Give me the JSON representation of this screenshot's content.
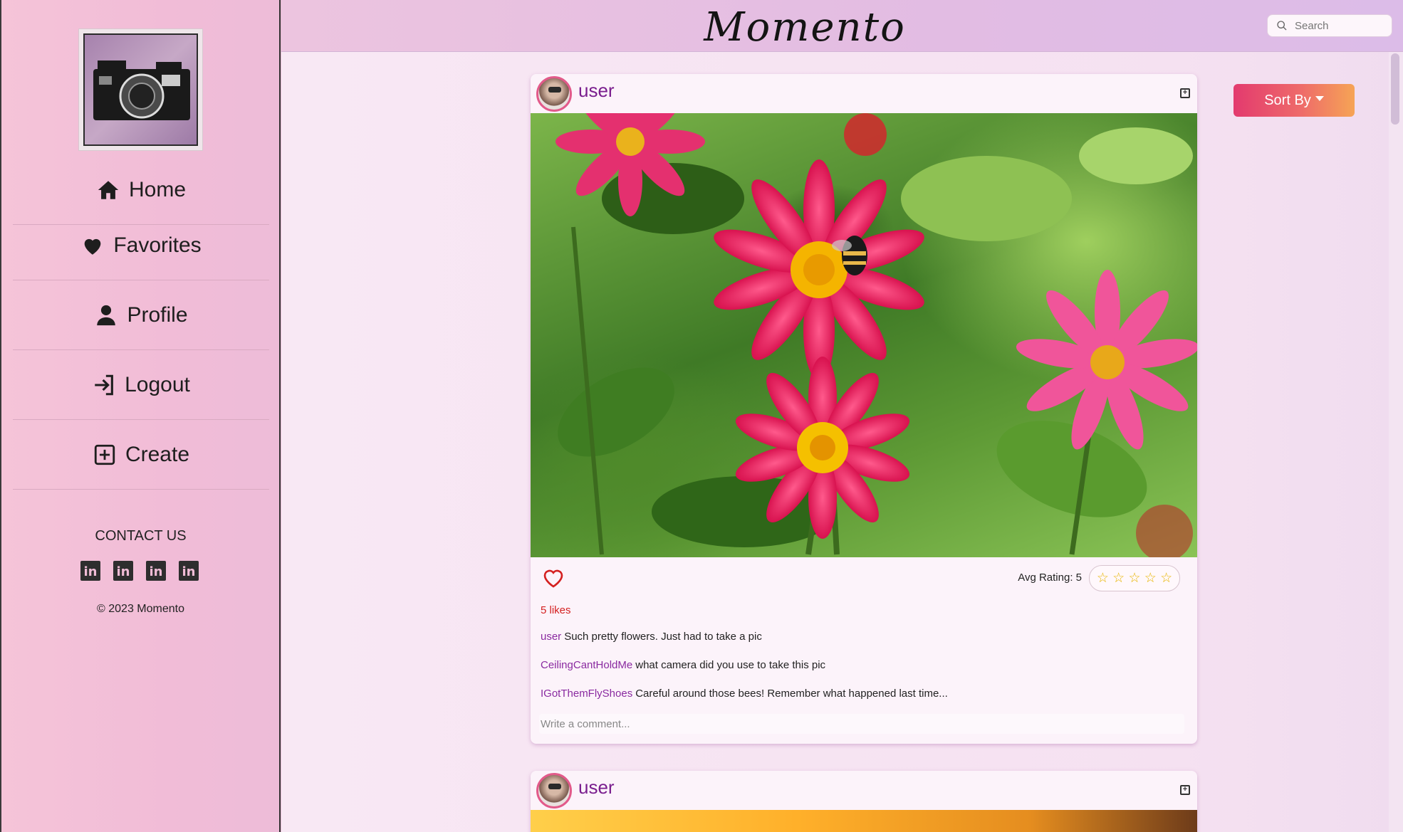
{
  "app": {
    "title": "Momento"
  },
  "header": {
    "search_placeholder": "Search"
  },
  "sidebar": {
    "items": [
      {
        "label": "Home",
        "icon": "home-icon"
      },
      {
        "label": "Favorites",
        "icon": "heart-icon"
      },
      {
        "label": "Profile",
        "icon": "user-icon"
      },
      {
        "label": "Logout",
        "icon": "logout-icon"
      },
      {
        "label": "Create",
        "icon": "plus-square-icon"
      }
    ],
    "contact_label": "CONTACT US",
    "social": [
      "in",
      "in",
      "in",
      "in"
    ],
    "copyright": "© 2023 Momento"
  },
  "toolbar": {
    "sort_label": "Sort By"
  },
  "posts": [
    {
      "username": "user",
      "likes_text": "5 likes",
      "rating_label": "Avg Rating: 5",
      "stars": "☆ ☆ ☆ ☆ ☆",
      "comments": [
        {
          "user": "user",
          "text": "Such pretty flowers. Just had to take a pic"
        },
        {
          "user": "CeilingCantHoldMe",
          "text": "what camera did you use to take this pic"
        },
        {
          "user": "IGotThemFlyShoes",
          "text": "Careful around those bees! Remember what happened last time..."
        }
      ],
      "comment_placeholder": "Write a comment..."
    },
    {
      "username": "user"
    }
  ],
  "colors": {
    "accent_purple": "#7a1e8e",
    "likes_red": "#d42020",
    "sort_gradient_start": "#e33a6e",
    "sort_gradient_end": "#f6a455"
  }
}
